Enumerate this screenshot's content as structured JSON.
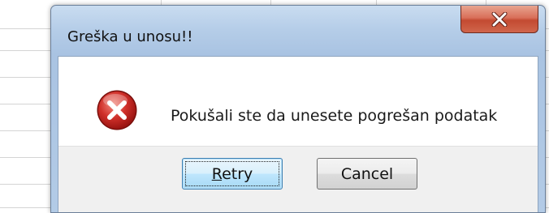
{
  "window": {
    "title": "Greška u unosu!!",
    "close_icon": "close-icon"
  },
  "dialog": {
    "icon": "error-icon",
    "message": "Pokušali ste da unesete pogrešan podatak"
  },
  "buttons": {
    "retry_mnemonic": "R",
    "retry_rest": "etry",
    "cancel_label": "Cancel"
  },
  "colors": {
    "titlebar": "#b5cde8",
    "close_button": "#c34a31",
    "error_icon": "#c0282a",
    "default_button_border": "#3c7fb1"
  }
}
